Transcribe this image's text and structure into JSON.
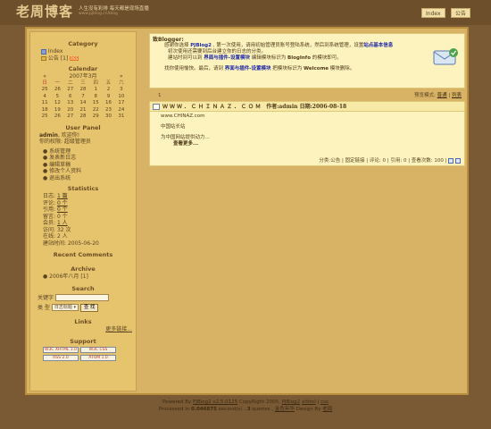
{
  "header": {
    "logo": "老周博客",
    "slogan": "人生没有彩排 每天都是现场直播",
    "url": "www.pjblog.cn/blog",
    "nav": [
      "Index",
      "公告"
    ]
  },
  "sidebar": {
    "category": {
      "title": "Category",
      "items": [
        "Index",
        "公告 [1]"
      ],
      "rss_badge": "RSS"
    },
    "calendar": {
      "title": "Calendar",
      "caption_prev": "«",
      "caption": "2007年3月",
      "caption_next": "»",
      "weekdays": [
        "日",
        "一",
        "二",
        "三",
        "四",
        "五",
        "六"
      ],
      "weeks": [
        [
          "25",
          "26",
          "27",
          "28",
          "1",
          "2",
          "3"
        ],
        [
          "4",
          "5",
          "6",
          "7",
          "8",
          "9",
          "10"
        ],
        [
          "11",
          "12",
          "13",
          "14",
          "15",
          "16",
          "17"
        ],
        [
          "18",
          "19",
          "20",
          "21",
          "22",
          "23",
          "24"
        ],
        [
          "25",
          "26",
          "27",
          "28",
          "29",
          "30",
          "31"
        ]
      ]
    },
    "user_panel": {
      "title": "User Panel",
      "greeting_name": "admin",
      "greeting_suffix": ", 欢迎你!",
      "role": "你的权限: 超级管理员",
      "links": [
        "系统管理",
        "发表新日志",
        "编辑草稿",
        "修改个人资料",
        "退出系统"
      ]
    },
    "statistics": {
      "title": "Statistics",
      "rows": [
        {
          "label": "日志:",
          "value": "1 篇",
          "unit": ""
        },
        {
          "label": "评论:",
          "value": "0 个",
          "unit": ""
        },
        {
          "label": "引用:",
          "value": "0 个",
          "unit": ""
        },
        {
          "label": "留言:",
          "value": "0 个",
          "unit": ""
        },
        {
          "label": "会员:",
          "value": "1 人",
          "unit": ""
        },
        {
          "label": "访问:",
          "value": "32",
          "unit": "次"
        },
        {
          "label": "在线:",
          "value": "2",
          "unit": "人"
        },
        {
          "label": "建站时间:",
          "value": "2005-06-20",
          "unit": ""
        }
      ]
    },
    "recent_comments": {
      "title": "Recent Comments"
    },
    "archive": {
      "title": "Archive",
      "items": [
        "2006年八月 [1]"
      ]
    },
    "search": {
      "title": "Search",
      "keyword_label": "关键字",
      "keyword_value": "",
      "type_label": "类  型",
      "type_selected": "日志标题",
      "button": "查 找"
    },
    "links": {
      "title": "Links",
      "more": "更多链接..."
    },
    "support": {
      "title": "Support",
      "badges": [
        "W3C XHTML 1.0",
        "W3C CSS",
        "RSS 2.0",
        "ATOM 1.0"
      ]
    }
  },
  "main": {
    "notice": {
      "title": "致Blogger:",
      "line1_pre": "感谢你选择 ",
      "line1_link": "PJBlog2",
      "line1_post": " , 第一次使用，请用初始管理员账号登陆系统，然后到系统管理，设置",
      "line1_link2": "站点基本信息",
      "line2": "初次使用还需要到后台建立你的日志的分类。",
      "line3_pre": "建站时间可以到 ",
      "line3_link": "界面与插件-设置模块",
      "line3_mid": " 编辑模块标识为 ",
      "line3_tag": "BlogInfo",
      "line3_post": " 的模块即可。",
      "line4_pre": "找你使用愉快。最后，请到 ",
      "line4_link": "界面与插件-设置模块",
      "line4_mid": " 把模块标识为 ",
      "line4_tag": "Welcome",
      "line4_post": " 模块删除。"
    },
    "controls": {
      "page": "1",
      "view_label": "预览模式:",
      "normal": "普通",
      "list": "列表"
    },
    "article": {
      "title": "ＷＷＷ．ＣＨＩＮＡＺ．ＣＯＭ",
      "meta": "作者:admin 日期:2006-08-18",
      "url": "www.CHINAZ.com",
      "line1": "中国站长站",
      "line2": "为中国网站提供动力...",
      "more": "查看更多...",
      "footer": "分类:公告 | 固定链接 | 评论: 0 | 引用: 0 | 查看次数: 100 |"
    }
  },
  "footer": {
    "line1_pre": "Powered By ",
    "line1_link": "PJBlog2 v2.5.0125",
    "line1_mid": " CopyRight 2005, ",
    "line1_link2": "PJBlog2",
    "line1_xhtml": "xhtml",
    "line1_css": "css",
    "line2_pre": "Processed in ",
    "line2_time": "0.046875",
    "line2_mid": " second(s) , ",
    "line2_queries": "3",
    "line2_post": " queries , ",
    "line2_skin": "金色年华",
    "line2_design": " Design By ",
    "line2_author": "老周"
  }
}
